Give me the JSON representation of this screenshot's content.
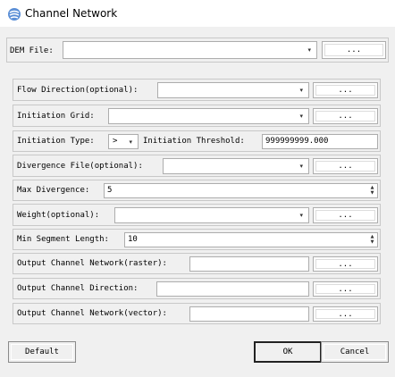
{
  "window": {
    "title": "Channel Network",
    "icon": "app-icon"
  },
  "dem_file": {
    "label": "DEM File:",
    "value": "",
    "browse": "..."
  },
  "flow_direction": {
    "label": "Flow Direction(optional):",
    "value": "",
    "browse": "..."
  },
  "initiation_grid": {
    "label": "Initiation Grid:",
    "value": "",
    "browse": "..."
  },
  "initiation": {
    "type_label": "Initiation Type:",
    "type_value": ">",
    "threshold_label": "Initiation Threshold:",
    "threshold_value": "999999999.000"
  },
  "divergence_file": {
    "label": "Divergence File(optional):",
    "value": "",
    "browse": "..."
  },
  "max_divergence": {
    "label": "Max Divergence:",
    "value": "5"
  },
  "weight": {
    "label": "Weight(optional):",
    "value": "",
    "browse": "..."
  },
  "min_segment": {
    "label": "Min Segment Length:",
    "value": "10"
  },
  "output_raster": {
    "label": "Output Channel Network(raster):",
    "value": "",
    "browse": "..."
  },
  "output_direction": {
    "label": "Output Channel Direction:",
    "value": "",
    "browse": "..."
  },
  "output_vector": {
    "label": "Output Channel Network(vector):",
    "value": "",
    "browse": "..."
  },
  "buttons": {
    "default": "Default",
    "ok": "OK",
    "cancel": "Cancel"
  }
}
